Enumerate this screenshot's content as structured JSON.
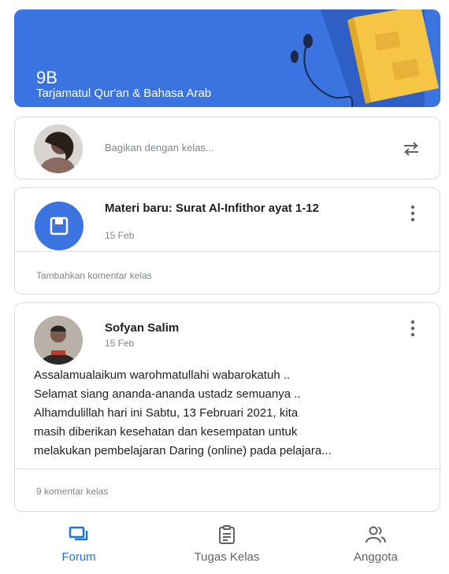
{
  "banner": {
    "class_name": "9B",
    "class_subtitle": "Tarjamatul Qur'an & Bahasa Arab"
  },
  "share": {
    "placeholder": "Bagikan dengan kelas..."
  },
  "materi_post": {
    "title": "Materi baru: Surat Al-Infithor ayat 1-12",
    "date": "15 Feb",
    "comment_prompt": "Tambahkan komentar kelas"
  },
  "announcement": {
    "author": "Sofyan Salim",
    "date": "15 Feb",
    "body_lines": [
      "Assalamualaikum warohmatullahi wabarokatuh ..",
      "Selamat siang ananda-ananda ustadz semuanya ..",
      "Alhamdulillah hari ini Sabtu, 13 Februari 2021, kita",
      "masih diberikan kesehatan dan kesempatan untuk",
      "melakukan pembelajaran Daring (online) pada pelajara..."
    ],
    "comments": "9 komentar kelas"
  },
  "nav": {
    "forum": "Forum",
    "tugas": "Tugas Kelas",
    "anggota": "Anggota"
  },
  "colors": {
    "accent": "#1a73e8",
    "banner": "#3b73e0"
  }
}
